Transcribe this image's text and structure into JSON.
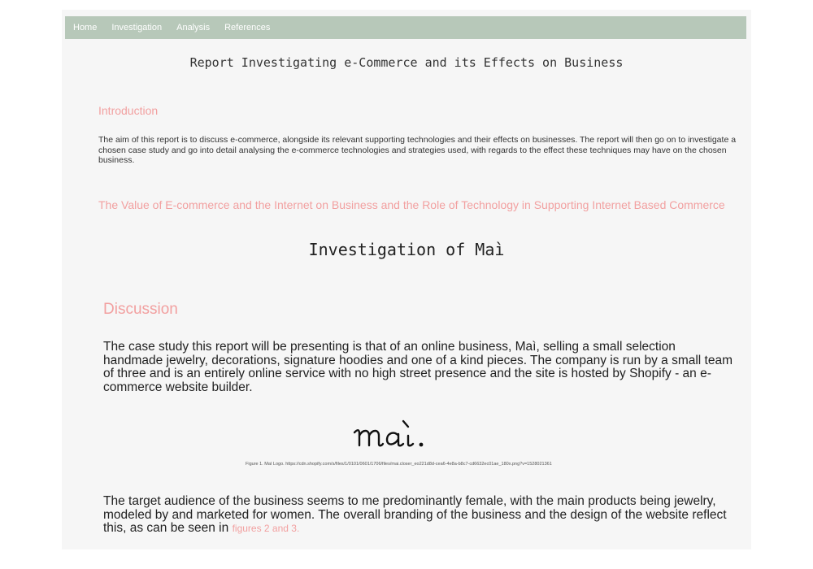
{
  "nav": {
    "items": [
      "Home",
      "Investigation",
      "Analysis",
      "References"
    ]
  },
  "report": {
    "title": "Report Investigating e-Commerce and its Effects on Business"
  },
  "introduction": {
    "heading": "Introduction",
    "text": "The aim of this report is to discuss e-commerce, alongside its relevant supporting technologies and their effects on businesses. The report will then go on to investigate a chosen case study and go into detail analysing the e-commerce technologies and strategies used, with regards to the effect these techniques may have on the chosen business."
  },
  "value_section": {
    "heading": "The Value of E-commerce and the Internet on Business and the Role of Technology in Supporting Internet Based Commerce"
  },
  "investigation": {
    "title": "Investigation of Maì"
  },
  "discussion": {
    "heading": "Discussion",
    "text": "The case study this report will be presenting is that of an online business, Maì, selling a small selection handmade jewelry, decorations, signature hoodies and one of a kind pieces. The company is run by a small team of three and is an entirely online service with no high street presence and the site is hosted by Shopify - an e-commerce website builder."
  },
  "figure": {
    "logo_text": "maì.",
    "caption": "Figure 1. Maì Logo. https://cdn.shopify.com/s/files/1/0101/0601/1706/files/mai.closer_eo221d8d-cea6-4e8a-b8c7-cd6632ec01ae_180x.png?v=1528021361"
  },
  "audience": {
    "text": "The target audience of the business seems to me predominantly female, with the main products being jewelry, modeled by and marketed for women. The overall branding of the business and the design of the website reflect this, as can be seen in",
    "link": "figures 2 and 3."
  },
  "colors": {
    "nav_bg": "#b7c8b9",
    "heading_pink": "#f2a0a0",
    "page_bg": "#f6f6f6"
  }
}
